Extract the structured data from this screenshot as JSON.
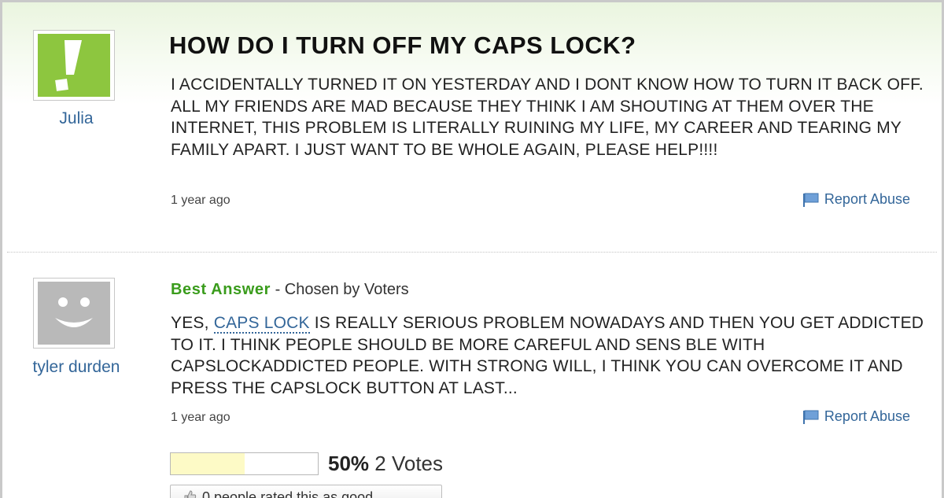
{
  "question": {
    "user": {
      "name": "Julia",
      "avatar_icon": "yahoo-exclamation-icon",
      "avatar_color": "#8dc63f"
    },
    "title": "HOW DO I TURN OFF MY CAPS LOCK?",
    "body": "I ACCIDENTALLY TURNED IT ON YESTERDAY AND I DONT KNOW HOW TO TURN IT BACK OFF. ALL MY FRIENDS ARE MAD BECAUSE THEY THINK I AM SHOUTING AT THEM OVER THE INTERNET, THIS PROBLEM IS LITERALLY RUINING MY LIFE, MY CAREER AND TEARING MY FAMILY APART. I JUST WANT TO BE WHOLE AGAIN, PLEASE HELP!!!!",
    "timestamp": "1 year ago",
    "report_label": "Report Abuse"
  },
  "answer": {
    "user": {
      "name": "tyler durden",
      "avatar_icon": "smiley-face-icon",
      "avatar_color": "#b9b9b9"
    },
    "best_label": "Best Answer",
    "chosen_by": "- Chosen by Voters",
    "body_prefix": "YES, ",
    "body_link": "CAPS LOCK",
    "body_rest": " IS REALLY SERIOUS PROBLEM NOWADAYS AND THEN YOU GET ADDICTED TO IT. I THINK PEOPLE SHOULD BE MORE CAREFUL AND SENS BLE WITH CAPSLOCKADDICTED PEOPLE. WITH STRONG WILL, I THINK YOU CAN OVERCOME IT AND PRESS THE CAPSLOCK BUTTON AT LAST...",
    "timestamp": "1 year ago",
    "report_label": "Report Abuse",
    "vote_percent_value": 0.5,
    "vote_percent": "50%",
    "vote_count": "2 Votes",
    "rate_text": "0 people rated this as good"
  },
  "colors": {
    "link": "#336699",
    "best_answer": "#3a9c1c",
    "vote_fill": "#fdfac6"
  }
}
